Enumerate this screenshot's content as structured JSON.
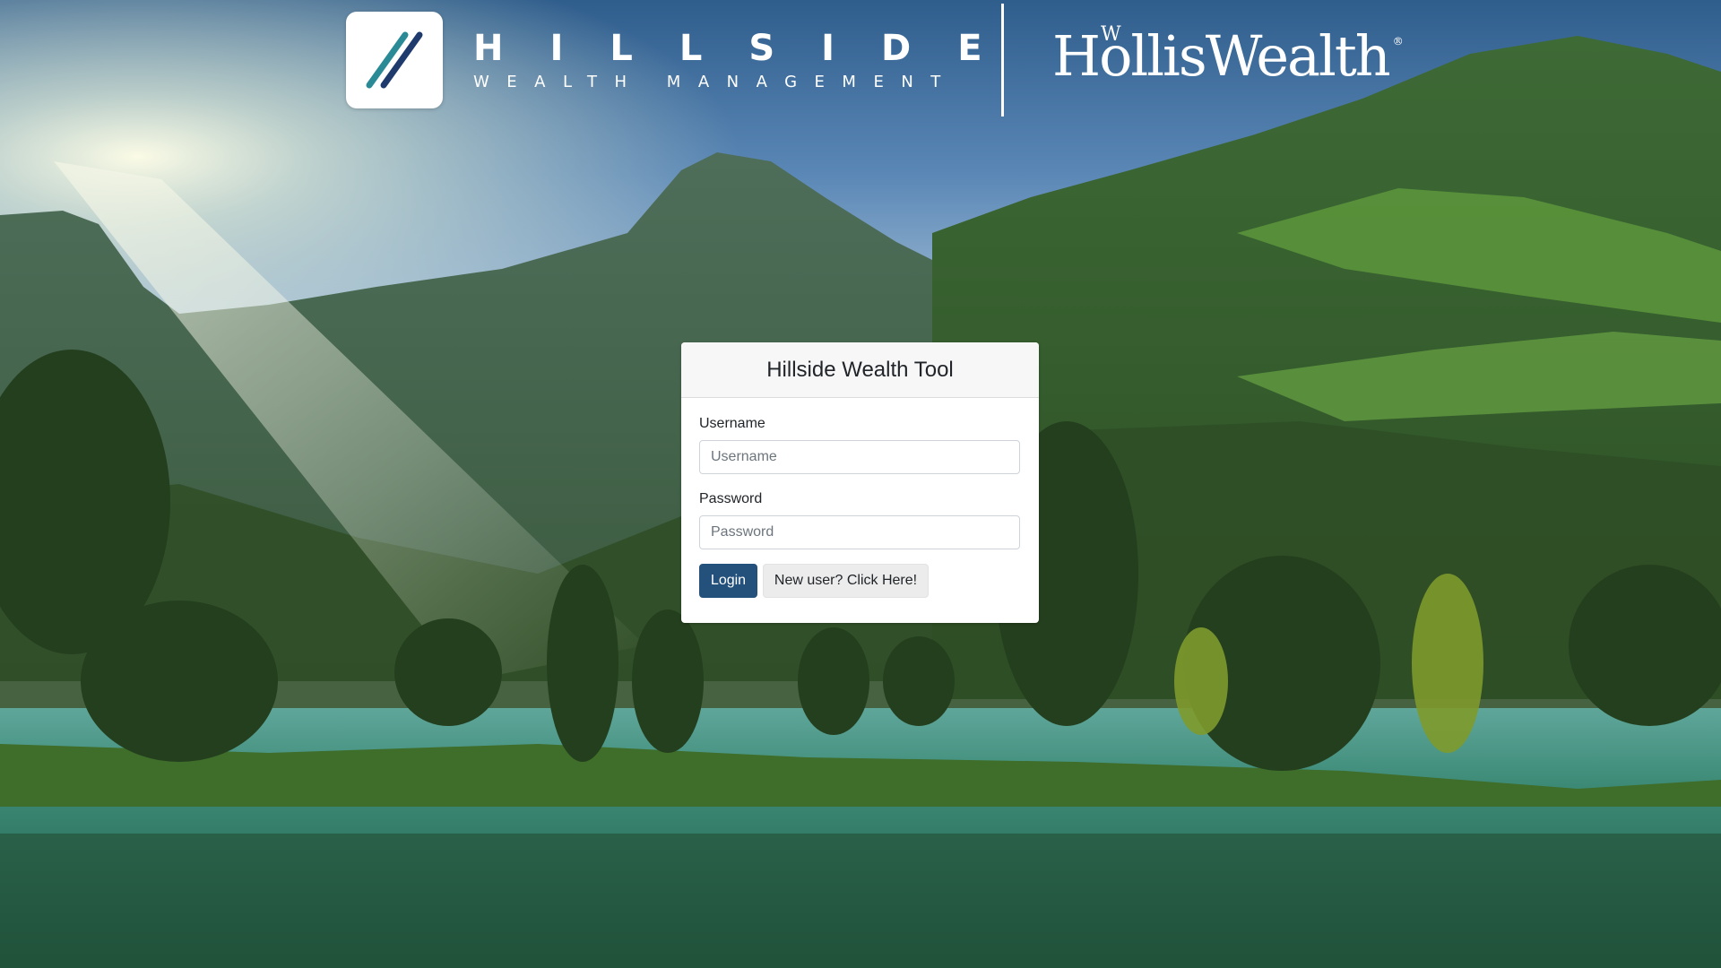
{
  "branding": {
    "hillside_name": "HILLSIDE",
    "hillside_sub": "WEALTH MANAGEMENT",
    "partner_mark": "W",
    "partner_name": "HollisWealth",
    "partner_reg": "®",
    "logo_colors": {
      "teal": "#2a8a96",
      "navy": "#1f3b6e"
    }
  },
  "login": {
    "title": "Hillside Wealth Tool",
    "username_label": "Username",
    "username_placeholder": "Username",
    "username_value": "",
    "password_label": "Password",
    "password_placeholder": "Password",
    "password_value": "",
    "login_button": "Login",
    "new_user_button": "New user? Click Here!"
  },
  "colors": {
    "primary": "#24507c",
    "secondary": "#ececec",
    "card_header": "#f7f7f7"
  }
}
